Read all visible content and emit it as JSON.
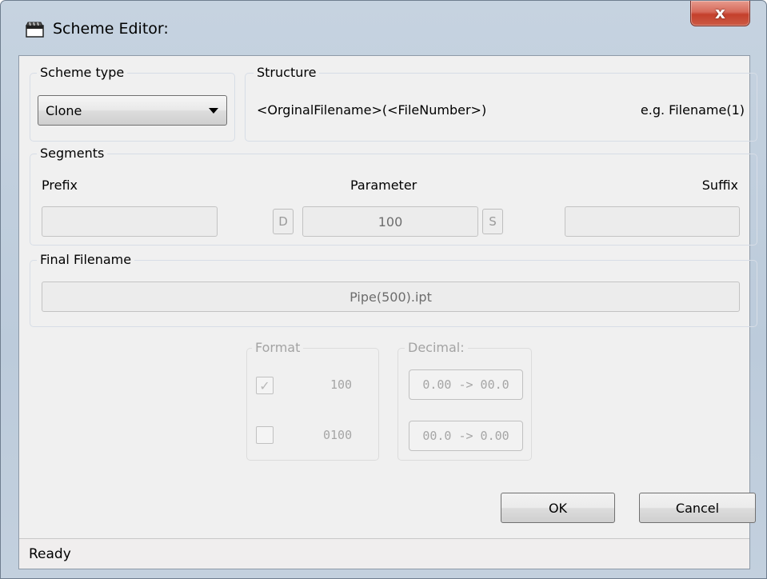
{
  "window": {
    "title": "Scheme Editor:",
    "close_glyph": "x"
  },
  "scheme_type": {
    "group_label": "Scheme type",
    "selected": "Clone"
  },
  "structure": {
    "group_label": "Structure",
    "pattern": "<OrginalFilename>(<FileNumber>)",
    "example": "e.g. Filename(1)"
  },
  "segments": {
    "group_label": "Segments",
    "prefix_label": "Prefix",
    "prefix_value": "",
    "parameter_label": "Parameter",
    "decrement_label": "D",
    "parameter_value": "100",
    "increment_label": "S",
    "suffix_label": "Suffix",
    "suffix_value": ""
  },
  "final_filename": {
    "group_label": "Final Filename",
    "value": "Pipe(500).ipt"
  },
  "format": {
    "group_label": "Format",
    "options": [
      {
        "label": "100",
        "checked": true,
        "check_glyph": "✓"
      },
      {
        "label": "0100",
        "checked": false,
        "check_glyph": ""
      }
    ]
  },
  "decimal": {
    "group_label": "Decimal:",
    "options": [
      "0.00 -> 00.0",
      "00.0 -> 0.00"
    ]
  },
  "buttons": {
    "ok": "OK",
    "cancel": "Cancel"
  },
  "status": {
    "text": "Ready"
  },
  "icons": {
    "title_icon": "scheme-app-icon",
    "close": "close-icon",
    "dropdown": "chevron-down-icon"
  }
}
